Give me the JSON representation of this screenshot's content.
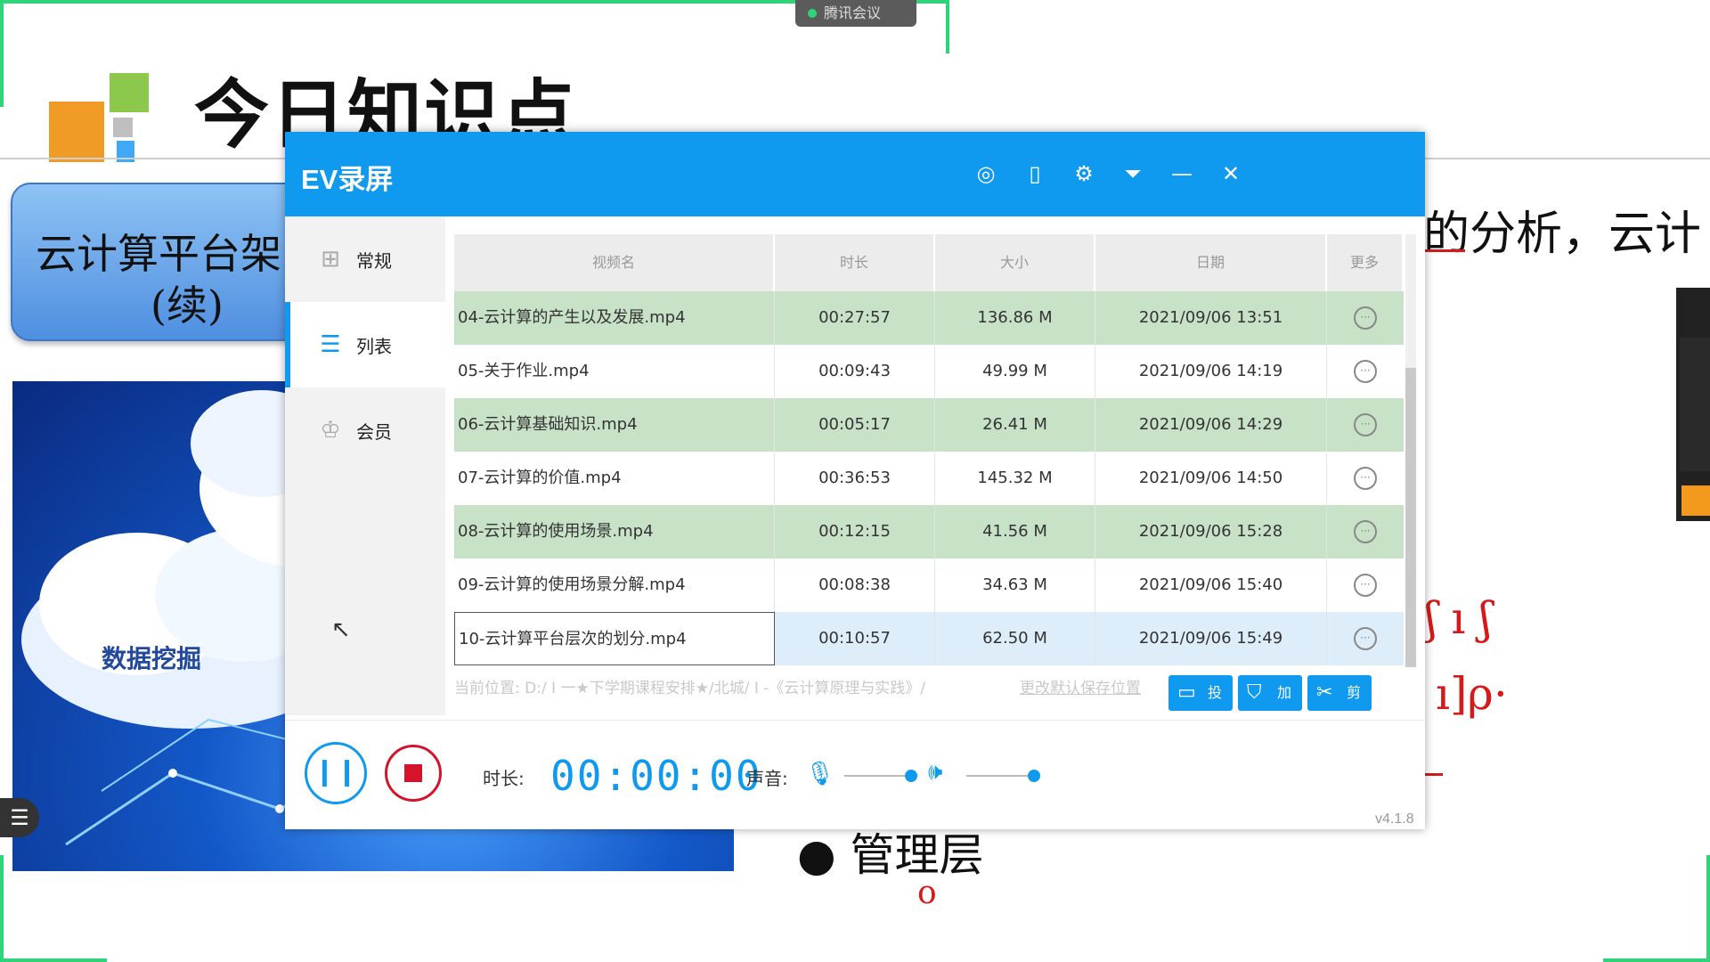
{
  "meeting": {
    "app_name": "腾讯会议"
  },
  "slide": {
    "title": "今日知识点",
    "box_line1": "云计算平台架",
    "box_line2": "(续)",
    "cloud_label": "数据挖掘",
    "right_text": "的分析，云计",
    "bullet_text": "管理层"
  },
  "window": {
    "title": "EV录屏",
    "toolbar_icons": [
      "user-icon",
      "phone-icon",
      "gear-icon",
      "dropdown-icon",
      "minimize-icon",
      "close-icon"
    ],
    "version": "v4.1.8"
  },
  "sidebar": {
    "items": [
      {
        "label": "常规",
        "icon": "grid-icon",
        "active": false
      },
      {
        "label": "列表",
        "icon": "list-icon",
        "active": true
      },
      {
        "label": "会员",
        "icon": "crown-icon",
        "active": false
      }
    ]
  },
  "table": {
    "headers": [
      "视频名",
      "时长",
      "大小",
      "日期",
      "更多"
    ],
    "rows": [
      {
        "name": "04-云计算的产生以及发展.mp4",
        "duration": "00:27:57",
        "size": "136.86 M",
        "date": "2021/09/06 13:51"
      },
      {
        "name": "05-关于作业.mp4",
        "duration": "00:09:43",
        "size": "49.99 M",
        "date": "2021/09/06 14:19"
      },
      {
        "name": "06-云计算基础知识.mp4",
        "duration": "00:05:17",
        "size": "26.41 M",
        "date": "2021/09/06 14:29"
      },
      {
        "name": "07-云计算的价值.mp4",
        "duration": "00:36:53",
        "size": "145.32 M",
        "date": "2021/09/06 14:50"
      },
      {
        "name": "08-云计算的使用场景.mp4",
        "duration": "00:12:15",
        "size": "41.56 M",
        "date": "2021/09/06 15:28"
      },
      {
        "name": "09-云计算的使用场景分解.mp4",
        "duration": "00:08:38",
        "size": "34.63 M",
        "date": "2021/09/06 15:40"
      },
      {
        "name": "10-云计算平台层次的划分.mp4",
        "duration": "00:10:57",
        "size": "62.50 M",
        "date": "2021/09/06 15:49"
      }
    ]
  },
  "footer": {
    "path": "当前位置: D:/ I 一★下学期课程安排★/北城/ I -《云计算原理与实践》/",
    "change_link": "更改默认保存位置",
    "btn_cast": "投屏",
    "btn_encrypt": "加密",
    "btn_edit": "剪辑"
  },
  "controls": {
    "duration_label": "时长:",
    "timer": "00:00:00",
    "volume_label": "声音:"
  },
  "colors": {
    "accent": "#0f9af0",
    "row_green": "#c8e2c7",
    "stop_red": "#d4142d"
  }
}
